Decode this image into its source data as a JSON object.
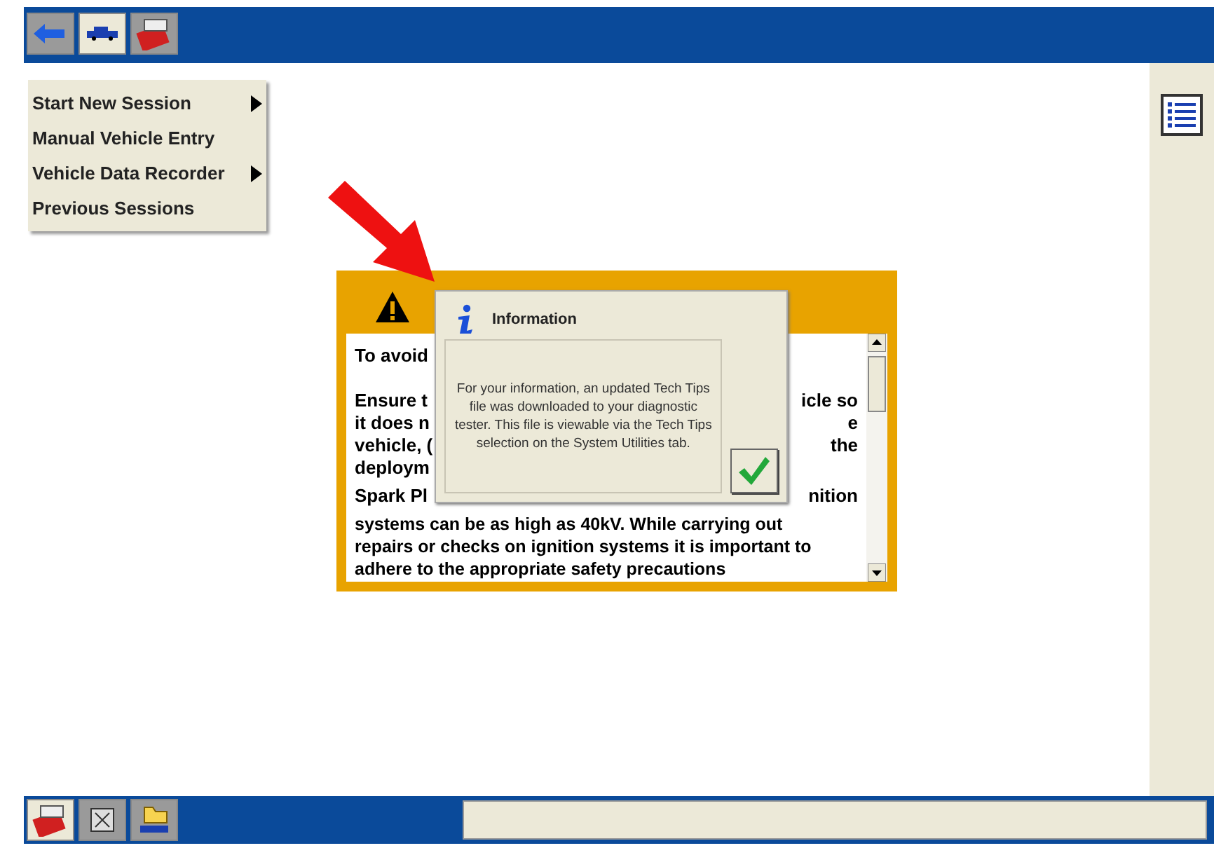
{
  "top_tabs": [
    {
      "kind": "back",
      "selected": false
    },
    {
      "kind": "vehicle",
      "selected": true
    },
    {
      "kind": "toolbox",
      "selected": false
    }
  ],
  "menu": [
    {
      "label": "Start New Session",
      "submenu": true
    },
    {
      "label": "Manual Vehicle Entry",
      "submenu": false
    },
    {
      "label": "Vehicle Data Recorder",
      "submenu": true
    },
    {
      "label": "Previous Sessions",
      "submenu": false
    }
  ],
  "warning": {
    "rows": [
      {
        "left": "To avoid",
        "right": ""
      },
      {
        "left": "",
        "right": ""
      },
      {
        "left": "Ensure t",
        "right": "icle so"
      },
      {
        "left": "it does n",
        "right": "e"
      },
      {
        "left": "vehicle, (",
        "right": "the"
      },
      {
        "left": "deploym",
        "right": ""
      }
    ],
    "rows2": [
      {
        "left": "Spark Pl",
        "right": "nition"
      }
    ],
    "lines": [
      "systems can be as high as 40kV. While carrying out",
      "repairs or checks on ignition systems it is important to",
      "adhere to the appropriate safety precautions"
    ]
  },
  "dialog": {
    "title": "Information",
    "message": "For your information, an updated Tech Tips file was downloaded to your diagnostic tester. This file is viewable via the Tech Tips selection on the System Utilities tab."
  },
  "bottom_tabs": [
    {
      "kind": "toolbox",
      "selected": true
    },
    {
      "kind": "scroll",
      "selected": false
    },
    {
      "kind": "folder",
      "selected": false
    }
  ]
}
